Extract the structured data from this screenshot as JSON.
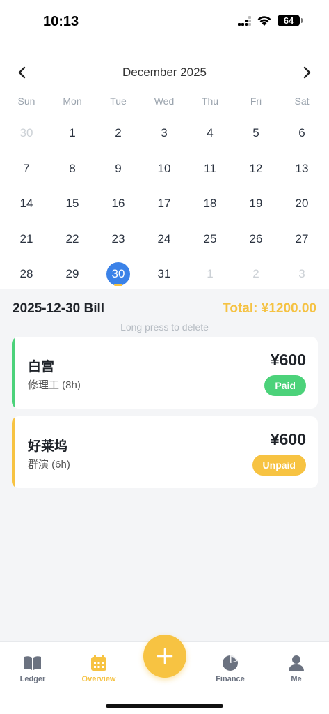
{
  "status": {
    "time": "10:13",
    "battery": "64"
  },
  "calendar": {
    "month_label": "December 2025",
    "weekdays": [
      "Sun",
      "Mon",
      "Tue",
      "Wed",
      "Thu",
      "Fri",
      "Sat"
    ],
    "days": [
      {
        "n": "30",
        "other": true
      },
      {
        "n": "1"
      },
      {
        "n": "2"
      },
      {
        "n": "3"
      },
      {
        "n": "4"
      },
      {
        "n": "5"
      },
      {
        "n": "6"
      },
      {
        "n": "7"
      },
      {
        "n": "8"
      },
      {
        "n": "9"
      },
      {
        "n": "10"
      },
      {
        "n": "11"
      },
      {
        "n": "12"
      },
      {
        "n": "13"
      },
      {
        "n": "14"
      },
      {
        "n": "15"
      },
      {
        "n": "16"
      },
      {
        "n": "17"
      },
      {
        "n": "18"
      },
      {
        "n": "19"
      },
      {
        "n": "20"
      },
      {
        "n": "21"
      },
      {
        "n": "22"
      },
      {
        "n": "23"
      },
      {
        "n": "24"
      },
      {
        "n": "25"
      },
      {
        "n": "26"
      },
      {
        "n": "27"
      },
      {
        "n": "28"
      },
      {
        "n": "29"
      },
      {
        "n": "30",
        "selected": true
      },
      {
        "n": "31"
      },
      {
        "n": "1",
        "other": true
      },
      {
        "n": "2",
        "other": true
      },
      {
        "n": "3",
        "other": true
      }
    ],
    "selected_color": "#3b82e8"
  },
  "bill": {
    "title": "2025-12-30 Bill",
    "total": "Total: ¥1200.00",
    "hint": "Long press to delete"
  },
  "records": [
    {
      "name": "白宫",
      "job": "修理工 (8h)",
      "amount": "¥600",
      "status": "Paid",
      "accent": "#4cd27a",
      "badge_color": "#4cd27a"
    },
    {
      "name": "好莱坞",
      "job": "群演 (6h)",
      "amount": "¥600",
      "status": "Unpaid",
      "accent": "#f7c342",
      "badge_color": "#f7c342"
    }
  ],
  "tabs": {
    "ledger": "Ledger",
    "overview": "Overview",
    "finance": "Finance",
    "me": "Me"
  },
  "colors": {
    "accent": "#f7c342",
    "text_muted": "#6b7280"
  }
}
